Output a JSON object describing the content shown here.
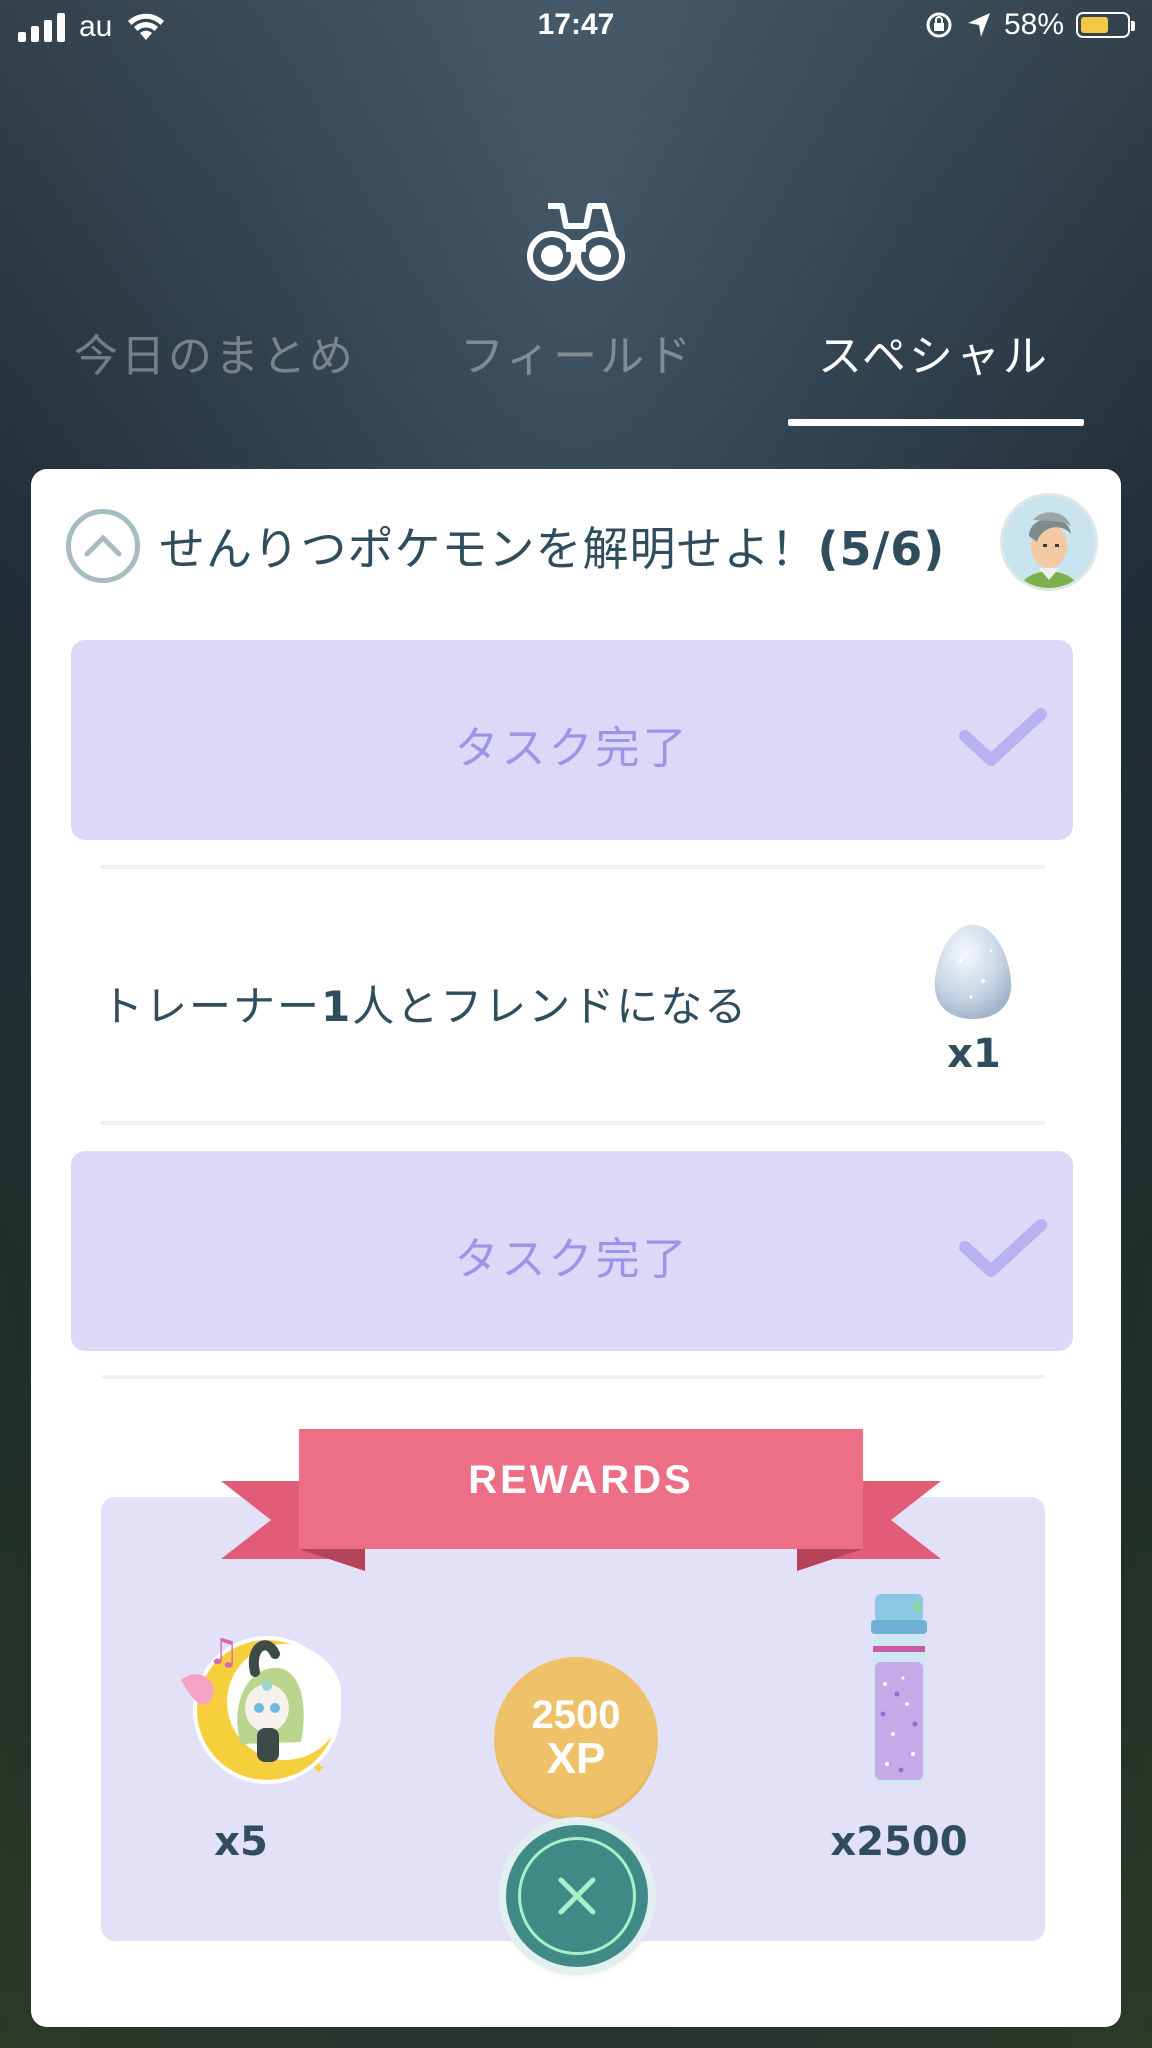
{
  "status_bar": {
    "carrier": "au",
    "time": "17:47",
    "battery_percent": "58%",
    "battery_color": "#f3c845"
  },
  "header": {
    "icon": "binoculars-icon"
  },
  "tabs": [
    {
      "label": "今日のまとめ",
      "active": false
    },
    {
      "label": "フィールド",
      "active": false
    },
    {
      "label": "スペシャル",
      "active": true
    }
  ],
  "research": {
    "title": "せんりつポケモンを解明せよ！",
    "progress": "(5/6)",
    "tasks": [
      {
        "status": "done",
        "label": "タスク完了"
      },
      {
        "status": "open",
        "text_prefix": "トレーナー",
        "text_num": "1",
        "text_suffix": "人とフレンドになる",
        "reward_icon": "egg-icon",
        "reward_count": "x1"
      },
      {
        "status": "done",
        "label": "タスク完了"
      }
    ]
  },
  "rewards": {
    "banner": "REWARDS",
    "items": [
      {
        "icon": "meloetta-sticker-icon",
        "count": "x5"
      },
      {
        "icon": "xp-coin-icon",
        "amount": "2500",
        "unit": "XP"
      },
      {
        "icon": "stardust-icon",
        "count": "x2500"
      }
    ]
  },
  "colors": {
    "task_done_bg": "#ddd8f7",
    "task_done_text": "#9b95e8",
    "ribbon": "#ec6f86",
    "close_button": "#3f8a86"
  }
}
